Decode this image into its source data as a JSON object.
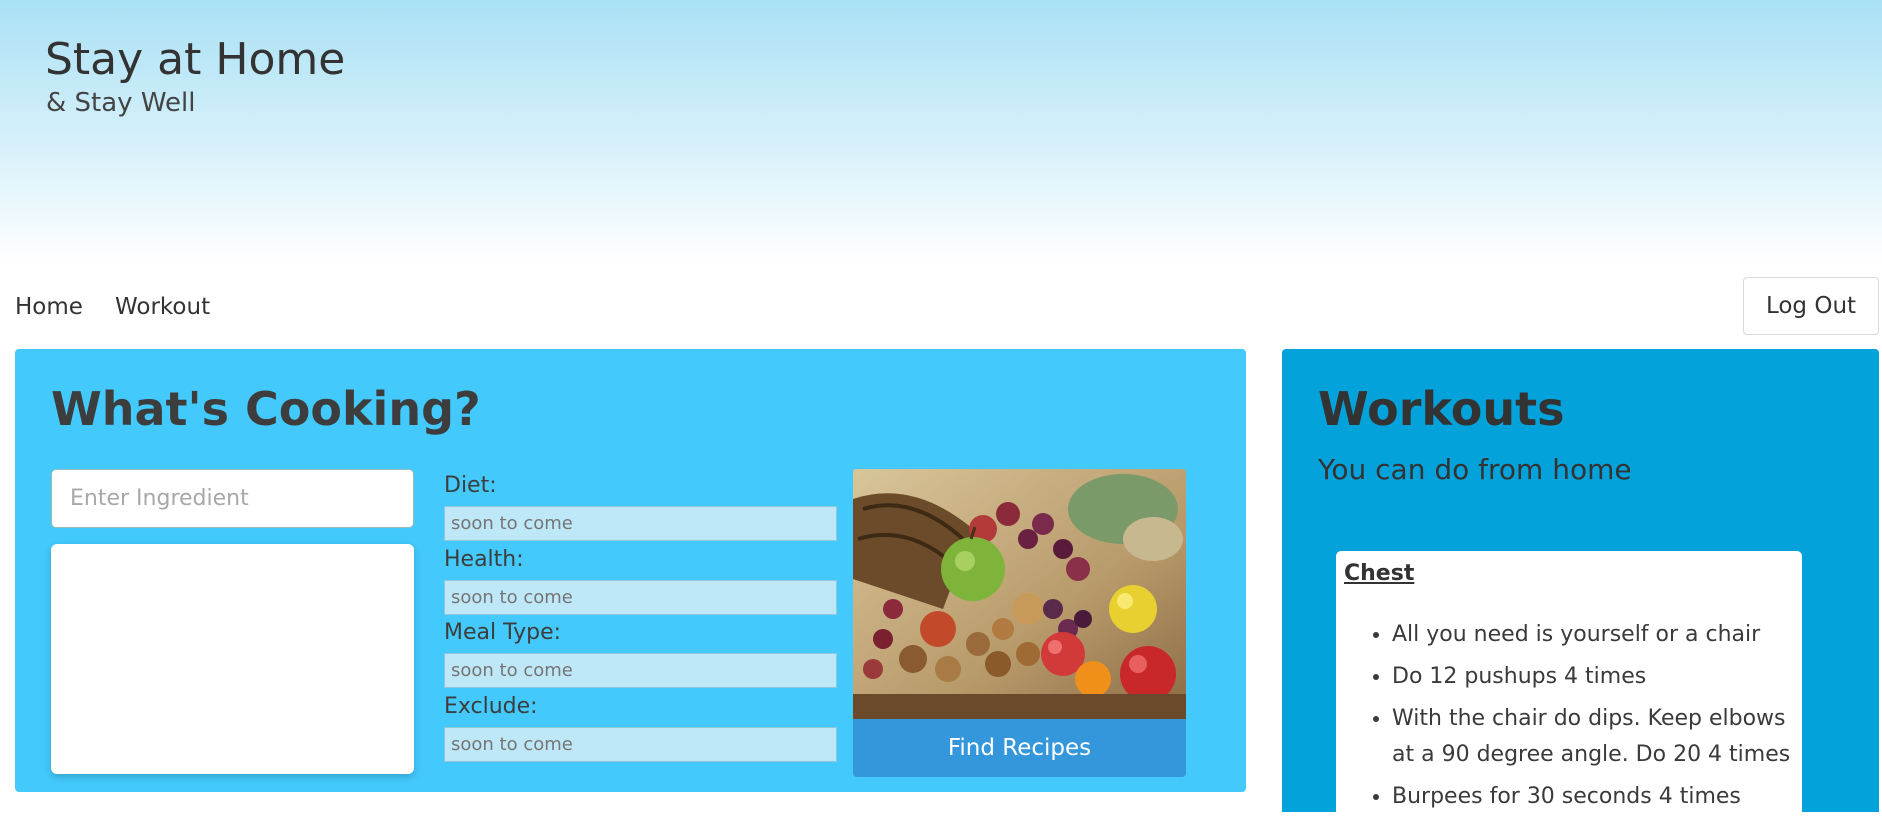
{
  "header": {
    "title": "Stay at Home",
    "subtitle": "& Stay Well"
  },
  "nav": {
    "home": "Home",
    "workout": "Workout",
    "logout": "Log Out"
  },
  "cooking": {
    "title": "What's Cooking?",
    "ingredient_placeholder": "Enter Ingredient",
    "fields": [
      {
        "label": "Diet:",
        "placeholder": "soon to come"
      },
      {
        "label": "Health:",
        "placeholder": "soon to come"
      },
      {
        "label": "Meal Type:",
        "placeholder": "soon to come"
      },
      {
        "label": "Exclude:",
        "placeholder": "soon to come"
      }
    ],
    "find_button": "Find Recipes"
  },
  "workouts": {
    "title": "Workouts",
    "subtitle": "You can do from home",
    "card_title": "Chest",
    "items": [
      "All you need is yourself or a chair",
      "Do 12 pushups 4 times",
      "With the chair do dips. Keep elbows at a 90 degree angle. Do 20 4 times",
      "Burpees for 30 seconds 4 times"
    ]
  }
}
